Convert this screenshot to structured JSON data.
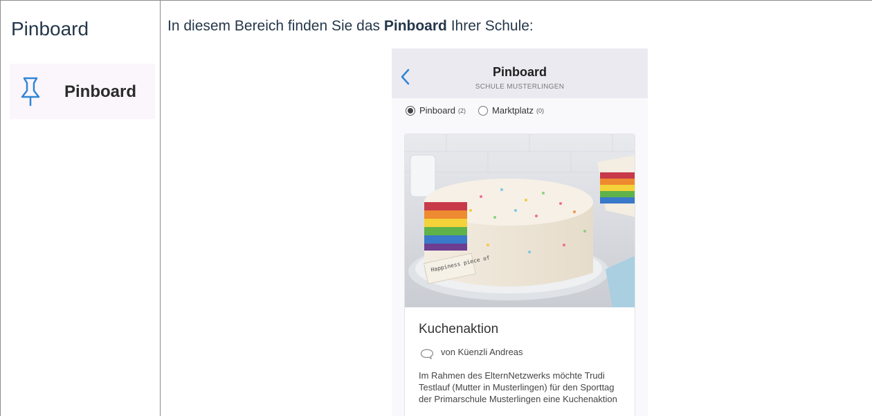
{
  "left": {
    "title": "Pinboard",
    "nav_item": {
      "label": "Pinboard",
      "icon": "pin-icon"
    }
  },
  "intro": {
    "prefix": "In diesem Bereich finden Sie das ",
    "bold": "Pinboard",
    "suffix": " Ihrer Schule:"
  },
  "phone": {
    "header": {
      "title": "Pinboard",
      "subtitle": "SCHULE MUSTERLINGEN",
      "back_icon": "chevron-left-icon"
    },
    "tabs": [
      {
        "label": "Pinboard",
        "count": "(2)",
        "selected": true
      },
      {
        "label": "Marktplatz",
        "count": "(0)",
        "selected": false
      }
    ],
    "post": {
      "image": "rainbow-cake-photo",
      "title": "Kuchenaktion",
      "author": "von Küenzli Andreas",
      "body": "Im Rahmen des ElternNetzwerks möchte Trudi Testlauf (Mutter in Musterlingen) für den Sporttag der Primarschule Musterlingen eine Kuchenaktion",
      "cake_topper_text": "Happiness piece of"
    }
  },
  "colors": {
    "accent_blue": "#2f86d6",
    "border": "#8c8c8c",
    "heading": "#25374a"
  }
}
